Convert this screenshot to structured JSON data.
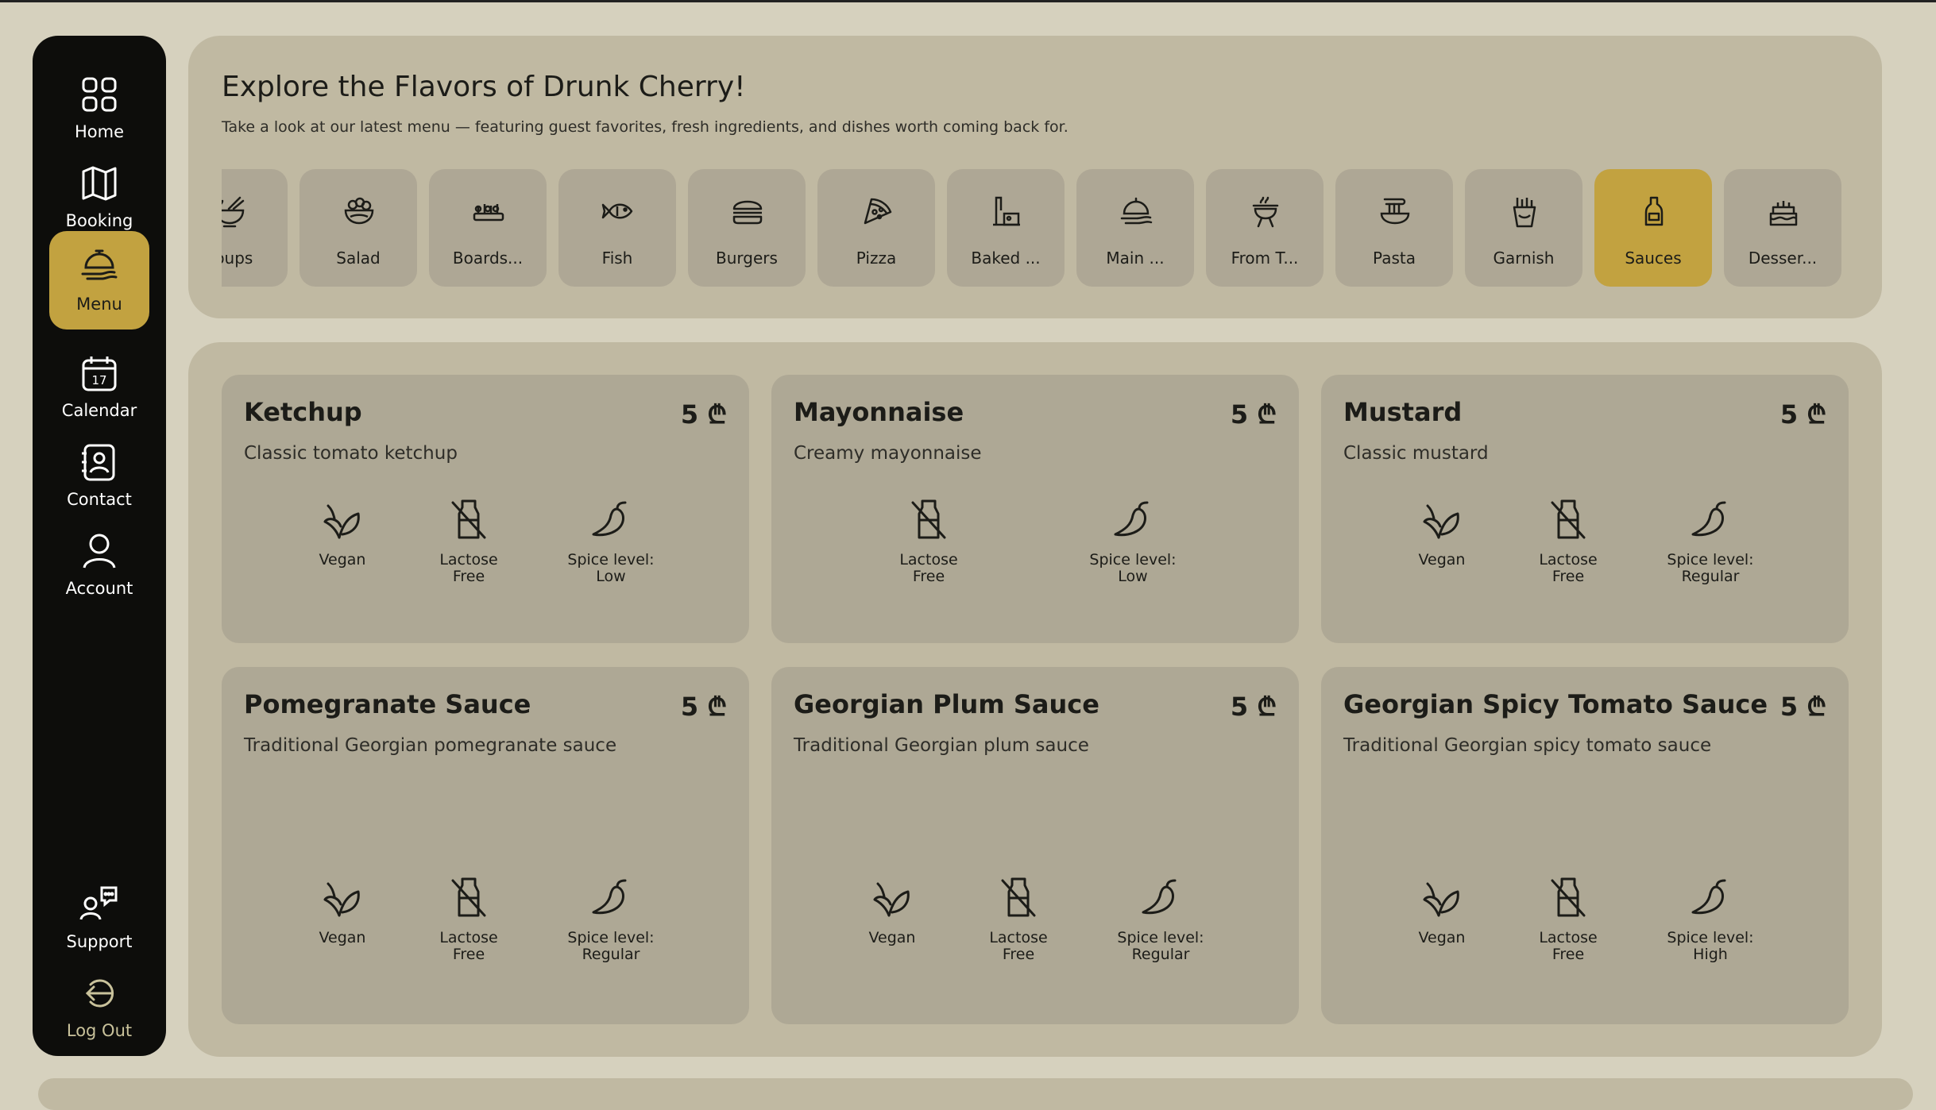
{
  "colors": {
    "accent": "#c2a240",
    "sidebar_bg": "#0d0d0b",
    "panel_bg": "#c0b9a2",
    "card_bg": "#aea895"
  },
  "nav": {
    "home": "Home",
    "booking": "Booking",
    "menu": "Menu",
    "calendar": "Calendar",
    "calendar_day": "17",
    "contact": "Contact",
    "account": "Account",
    "support": "Support",
    "logout": "Log Out"
  },
  "header": {
    "title": "Explore the Flavors of Drunk Cherry!",
    "subtitle": "Take a look at our latest menu — featuring guest favorites, fresh ingredients, and dishes worth coming back for."
  },
  "categories": [
    {
      "label": "Soups",
      "icon": "soup-bowl-icon"
    },
    {
      "label": "Salad",
      "icon": "salad-bowl-icon"
    },
    {
      "label": "Boards...",
      "icon": "board-icon"
    },
    {
      "label": "Fish",
      "icon": "fish-icon"
    },
    {
      "label": "Burgers",
      "icon": "burger-icon"
    },
    {
      "label": "Pizza",
      "icon": "pizza-icon"
    },
    {
      "label": "Baked ...",
      "icon": "oven-icon"
    },
    {
      "label": "Main ...",
      "icon": "cloche-icon"
    },
    {
      "label": "From T...",
      "icon": "grill-icon"
    },
    {
      "label": "Pasta",
      "icon": "pasta-icon"
    },
    {
      "label": "Garnish",
      "icon": "fries-icon"
    },
    {
      "label": "Sauces",
      "icon": "sauce-bottle-icon",
      "selected": true
    },
    {
      "label": "Desser...",
      "icon": "cake-icon"
    }
  ],
  "items": [
    {
      "name": "Ketchup",
      "price": "5 ₾",
      "description": "Classic tomato ketchup",
      "attrs": [
        "Vegan",
        "Lactose\nFree",
        "Spice level:\nLow"
      ]
    },
    {
      "name": "Mayonnaise",
      "price": "5 ₾",
      "description": "Creamy mayonnaise",
      "attrs": [
        "Lactose\nFree",
        "Spice level:\nLow"
      ]
    },
    {
      "name": "Mustard",
      "price": "5 ₾",
      "description": "Classic mustard",
      "attrs": [
        "Vegan",
        "Lactose\nFree",
        "Spice level:\nRegular"
      ]
    },
    {
      "name": "Pomegranate Sauce",
      "price": "5 ₾",
      "description": "Traditional Georgian pomegranate sauce",
      "attrs": [
        "Vegan",
        "Lactose\nFree",
        "Spice level:\nRegular"
      ]
    },
    {
      "name": "Georgian Plum Sauce",
      "price": "5 ₾",
      "description": "Traditional Georgian plum sauce",
      "attrs": [
        "Vegan",
        "Lactose\nFree",
        "Spice level:\nRegular"
      ]
    },
    {
      "name": "Georgian Spicy Tomato Sauce",
      "price": "5 ₾",
      "description": "Traditional Georgian spicy tomato sauce",
      "attrs": [
        "Vegan",
        "Lactose\nFree",
        "Spice level:\nHigh"
      ]
    }
  ]
}
